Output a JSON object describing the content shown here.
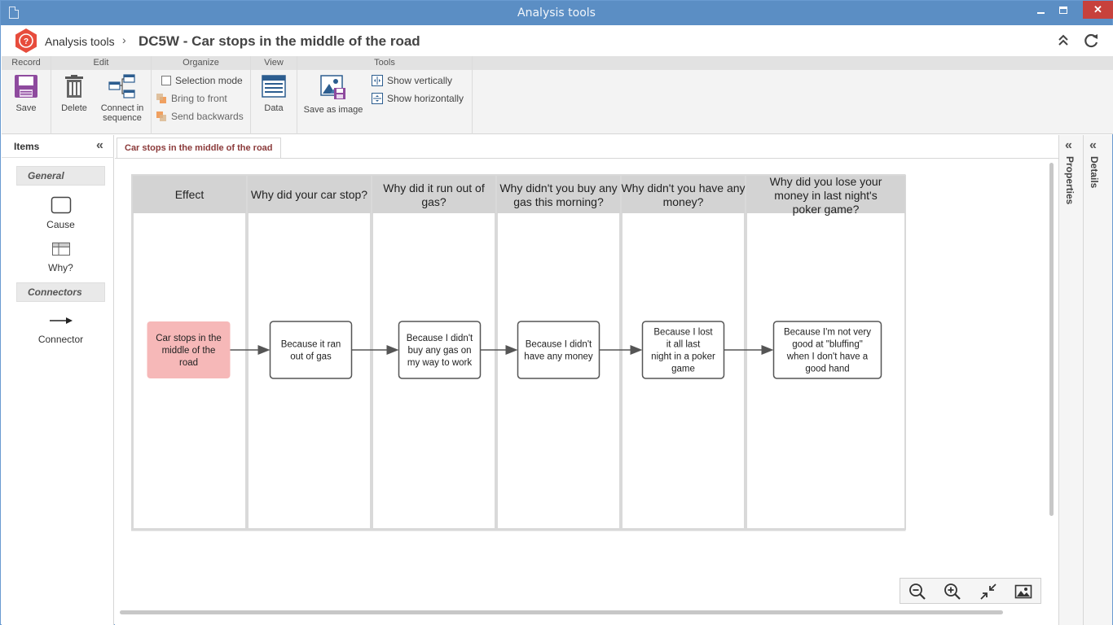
{
  "window": {
    "title": "Analysis tools"
  },
  "header": {
    "breadcrumb_app": "Analysis tools",
    "breadcrumb_sep": "›",
    "page_title": "DC5W - Car stops in the middle of the road"
  },
  "ribbon": {
    "groups": {
      "record": "Record",
      "edit": "Edit",
      "organize": "Organize",
      "view": "View",
      "tools": "Tools"
    },
    "save": "Save",
    "delete": "Delete",
    "connect_line1": "Connect in",
    "connect_line2": "sequence",
    "selection_mode": "Selection mode",
    "bring_to_front": "Bring to front",
    "send_backwards": "Send backwards",
    "data": "Data",
    "save_as_image": "Save as image",
    "show_vertically": "Show vertically",
    "show_horizontally": "Show horizontally"
  },
  "items_panel": {
    "title": "Items",
    "sections": {
      "general": "General",
      "connectors": "Connectors"
    },
    "tools": {
      "cause": "Cause",
      "why": "Why?",
      "connector": "Connector"
    }
  },
  "tab": {
    "label": "Car stops in the middle of the road"
  },
  "diagram": {
    "columns": [
      {
        "header": "Effect",
        "node": "Car stops in the middle of the road",
        "is_effect": true
      },
      {
        "header": "Why did your car stop?",
        "node": "Because it ran out of gas"
      },
      {
        "header": "Why did it run out of gas?",
        "node": "Because I didn't buy any gas on my way to work"
      },
      {
        "header": "Why didn't you buy any gas this morning?",
        "node": "Because I didn't have any money"
      },
      {
        "header": "Why didn't you have any money?",
        "node": "Because I lost it all last night in a poker game"
      },
      {
        "header": "Why did you lose your money in last night's poker game?",
        "node": "Because I'm not very good at \"bluffing\" when I don't have a good hand"
      }
    ],
    "colors": {
      "effect_fill": "#f6b8b8",
      "header_fill": "#d3d3d3",
      "lane_border": "#d9d9d9",
      "node_border": "#555555"
    }
  },
  "side_tabs": {
    "properties": "Properties",
    "details": "Details"
  },
  "zoom_controls": [
    "zoom-out-icon",
    "zoom-in-icon",
    "fit-screen-icon",
    "image-icon"
  ]
}
